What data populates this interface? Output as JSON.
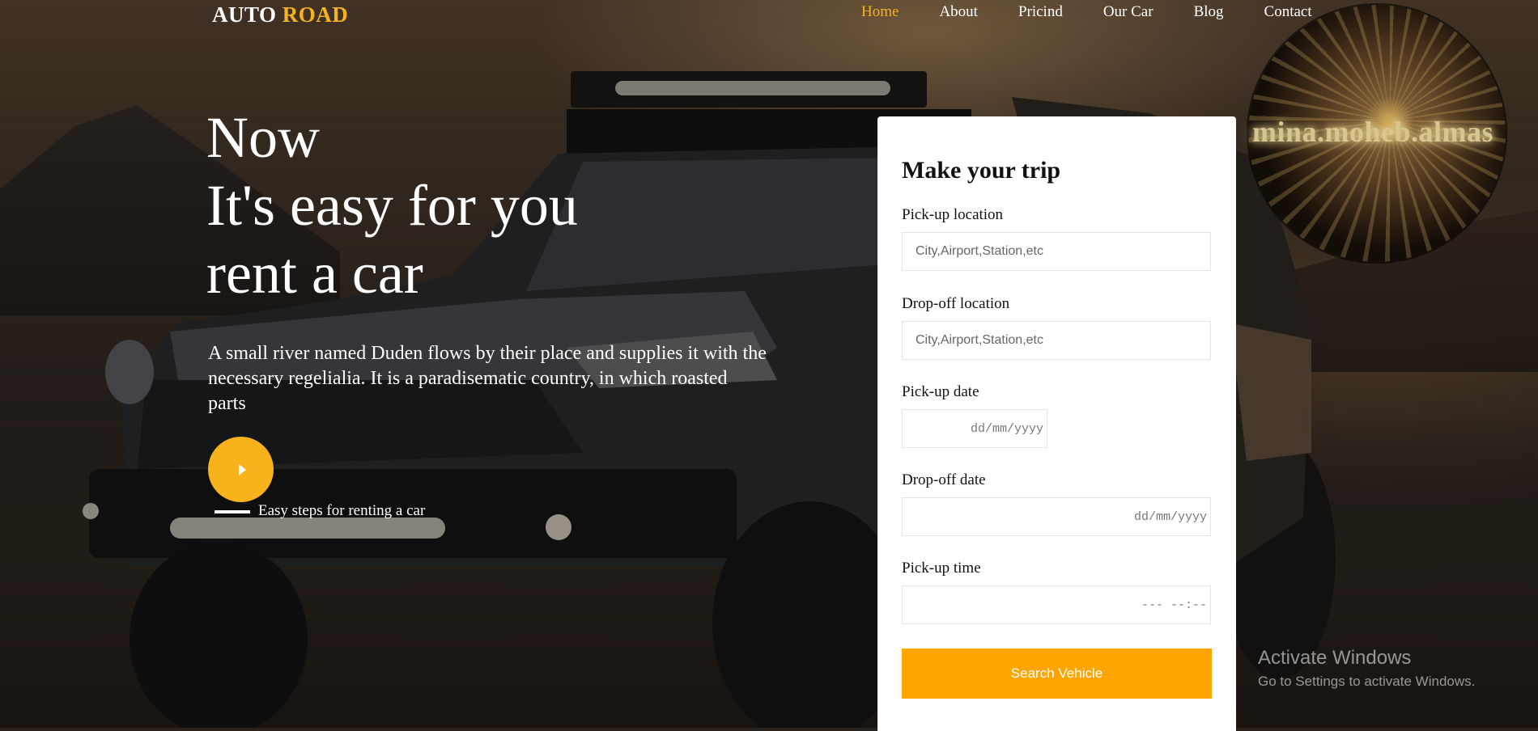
{
  "nav": {
    "brand_part1": "AUTO",
    "brand_part2": "ROAD",
    "items": [
      {
        "label": "Home",
        "active": true
      },
      {
        "label": "About"
      },
      {
        "label": "Pricind"
      },
      {
        "label": "Our Car"
      },
      {
        "label": "Blog"
      },
      {
        "label": "Contact"
      }
    ]
  },
  "hero": {
    "title_lines": [
      "Now",
      "It's easy for you",
      "rent a car"
    ],
    "description": "A small river named Duden flows by their place and supplies it with the necessary regelialia. It is a paradisematic country, in which roasted parts",
    "steps_label": "Easy steps for renting a car"
  },
  "watermark": {
    "text": "mina.moheb.almas"
  },
  "form": {
    "title": "Make your trip",
    "pickup_location_label": "Pick-up location",
    "pickup_location_placeholder": "City,Airport,Station,etc",
    "dropoff_location_label": "Drop-off location",
    "dropoff_location_placeholder": "City,Airport,Station,etc",
    "pickup_date_label": "Pick-up date",
    "pickup_date_placeholder": "dd/mm/yyyy",
    "dropoff_date_label": "Drop-off date",
    "dropoff_date_placeholder": "dd/mm/yyyy",
    "pickup_time_label": "Pick-up time",
    "pickup_time_placeholder": "--- --:--",
    "submit_label": "Search Vehicle"
  },
  "system": {
    "activate_title": "Activate Windows",
    "activate_sub": "Go to Settings to activate Windows."
  },
  "colors": {
    "accent": "#f7b21c",
    "button": "#ffa500",
    "card": "#ffffff"
  }
}
